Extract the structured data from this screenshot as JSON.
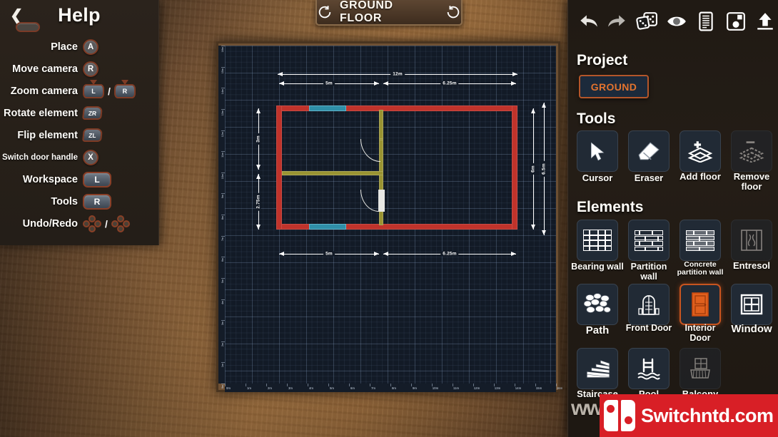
{
  "help": {
    "title": "Help",
    "back_icon": "chevron-left-icon",
    "rows": [
      {
        "label": "Place",
        "keys": [
          {
            "type": "circle",
            "text": "A"
          }
        ]
      },
      {
        "label": "Move camera",
        "keys": [
          {
            "type": "circle",
            "text": "R"
          }
        ]
      },
      {
        "label": "Zoom camera",
        "keys": [
          {
            "type": "stick",
            "text": "L"
          },
          {
            "type": "slash",
            "text": "/"
          },
          {
            "type": "stick",
            "text": "R"
          }
        ]
      },
      {
        "label": "Rotate element",
        "keys": [
          {
            "type": "trigger",
            "text": "ZR"
          }
        ]
      },
      {
        "label": "Flip element",
        "keys": [
          {
            "type": "trigger",
            "text": "ZL"
          }
        ]
      },
      {
        "label": "Switch door handle",
        "small": true,
        "keys": [
          {
            "type": "circle",
            "text": "X"
          }
        ]
      },
      {
        "label": "Workspace",
        "keys": [
          {
            "type": "bumper",
            "text": "L"
          }
        ]
      },
      {
        "label": "Tools",
        "keys": [
          {
            "type": "bumper",
            "text": "R"
          }
        ]
      },
      {
        "label": "Undo/Redo",
        "keys": [
          {
            "type": "dpad",
            "text": ""
          },
          {
            "type": "slash",
            "text": "/"
          },
          {
            "type": "dpad",
            "text": ""
          }
        ]
      }
    ]
  },
  "floor_header": {
    "title": "GROUND FLOOR",
    "prev_icon": "rotate-left-icon",
    "next_icon": "rotate-right-icon"
  },
  "toolbar": {
    "items": [
      {
        "name": "undo-icon",
        "label": "Undo"
      },
      {
        "name": "redo-icon",
        "label": "Redo"
      },
      {
        "name": "dice-icon",
        "label": "Randomize"
      },
      {
        "name": "eye-icon",
        "label": "Preview"
      },
      {
        "name": "document-icon",
        "label": "Notes"
      },
      {
        "name": "save-icon",
        "label": "Save"
      },
      {
        "name": "upload-icon",
        "label": "Export"
      }
    ]
  },
  "sidebar": {
    "project_title": "Project",
    "project_chip": "GROUND",
    "tools_title": "Tools",
    "tools": [
      {
        "label": "Cursor",
        "icon": "cursor-icon",
        "selected": false
      },
      {
        "label": "Eraser",
        "icon": "eraser-icon",
        "selected": false
      },
      {
        "label": "Add floor",
        "icon": "add-floor-icon",
        "selected": false
      },
      {
        "label": "Remove floor",
        "icon": "remove-floor-icon",
        "selected": false,
        "disabled": true
      }
    ],
    "elements_title": "Elements",
    "elements": [
      {
        "label": "Bearing wall",
        "icon": "bearing-wall-icon",
        "selected": false
      },
      {
        "label": "Partition wall",
        "icon": "partition-wall-icon",
        "selected": false
      },
      {
        "label": "Concrete partition wall",
        "icon": "concrete-partition-wall-icon",
        "selected": false,
        "small_label": true
      },
      {
        "label": "Entresol",
        "icon": "entresol-icon",
        "selected": false,
        "disabled": true
      },
      {
        "label": "Path",
        "icon": "path-icon",
        "selected": false
      },
      {
        "label": "Front Door",
        "icon": "front-door-icon",
        "selected": false
      },
      {
        "label": "Interior Door",
        "icon": "interior-door-icon",
        "selected": true,
        "small_label": true
      },
      {
        "label": "Window",
        "icon": "window-icon",
        "selected": false
      },
      {
        "label": "Staircase",
        "icon": "staircase-icon",
        "selected": false
      },
      {
        "label": "Pool",
        "icon": "pool-icon",
        "selected": false
      },
      {
        "label": "Balcony",
        "icon": "balcony-icon",
        "selected": false,
        "disabled": true
      }
    ]
  },
  "plan": {
    "dimensions": {
      "top_total": "12m",
      "top_left": "5m",
      "top_right": "6.25m",
      "bottom_left": "5m",
      "bottom_right": "6.25m",
      "left_upper": "3m",
      "left_lower": "2.75m",
      "right_inner": "6m",
      "right_outer": "6.5m"
    },
    "ruler_bottom_labels": [
      "0m",
      "1m",
      "2m",
      "3m",
      "4m",
      "5m",
      "6m",
      "7m",
      "8m",
      "9m",
      "10m",
      "11m",
      "12m",
      "13m",
      "14m",
      "15m",
      "16m"
    ],
    "ruler_left_labels": [
      "16m",
      "15m",
      "14m",
      "13m",
      "12m",
      "11m",
      "10m",
      "9m",
      "8m",
      "7m",
      "6m",
      "5m",
      "4m",
      "3m",
      "2m",
      "1m",
      "0m"
    ],
    "colors": {
      "bearing_wall": "#c0332b",
      "partition_wall": "#9a9432",
      "window": "#2f8fa8",
      "door": "#e8e8e4",
      "canvas_bg": "#121a26"
    }
  },
  "watermark": {
    "prefix": "www.",
    "text": "Switchntd.com",
    "logo": "nintendo-switch-logo"
  }
}
